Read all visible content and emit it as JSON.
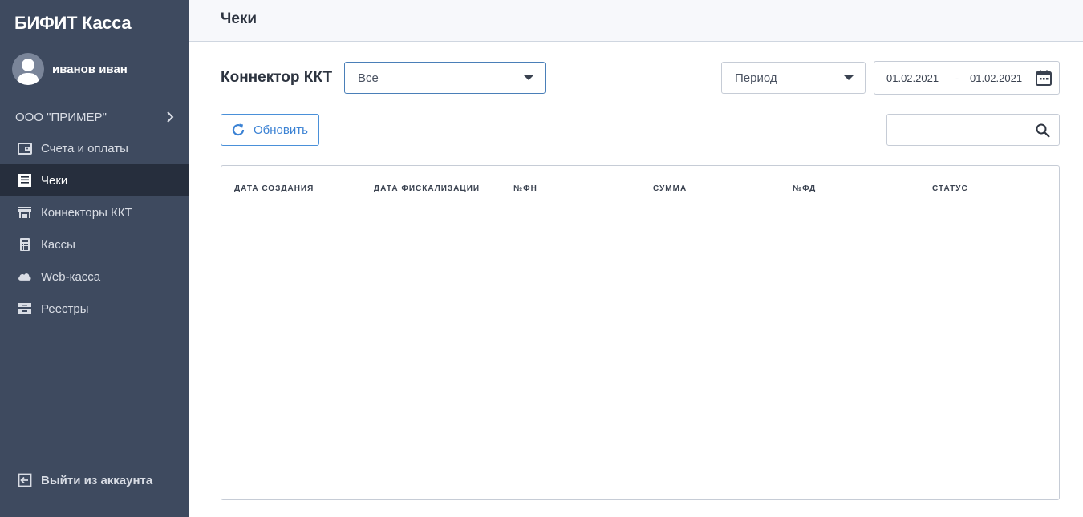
{
  "app": {
    "title": "БИФИТ Касса"
  },
  "user": {
    "name": "иванов иван"
  },
  "org": {
    "name": "ООО \"ПРИМЕР\""
  },
  "sidebar": {
    "items": [
      {
        "label": "Счета и оплаты",
        "icon": "wallet-icon"
      },
      {
        "label": "Чеки",
        "icon": "receipt-icon",
        "active": true
      },
      {
        "label": "Коннекторы ККТ",
        "icon": "store-icon"
      },
      {
        "label": "Кассы",
        "icon": "calculator-icon"
      },
      {
        "label": "Web-касса",
        "icon": "cloud-icon"
      },
      {
        "label": "Реестры",
        "icon": "archive-icon"
      }
    ],
    "logout_label": "Выйти из аккаунта"
  },
  "page": {
    "title": "Чеки"
  },
  "filters": {
    "kkt_label": "Коннектор ККТ",
    "kkt_value": "Все",
    "period_value": "Период",
    "date_from": "01.02.2021",
    "date_separator": "-",
    "date_to": "01.02.2021"
  },
  "toolbar": {
    "refresh_label": "Обновить",
    "search_value": ""
  },
  "table": {
    "columns": [
      "ДАТА СОЗДАНИЯ",
      "ДАТА ФИСКАЛИЗАЦИИ",
      "№ФН",
      "СУММА",
      "№ФД",
      "СТАТУС"
    ],
    "rows": []
  },
  "colors": {
    "sidebar_bg": "#3e4a5f",
    "sidebar_active_bg": "#262e3d",
    "accent": "#3b82d4"
  }
}
